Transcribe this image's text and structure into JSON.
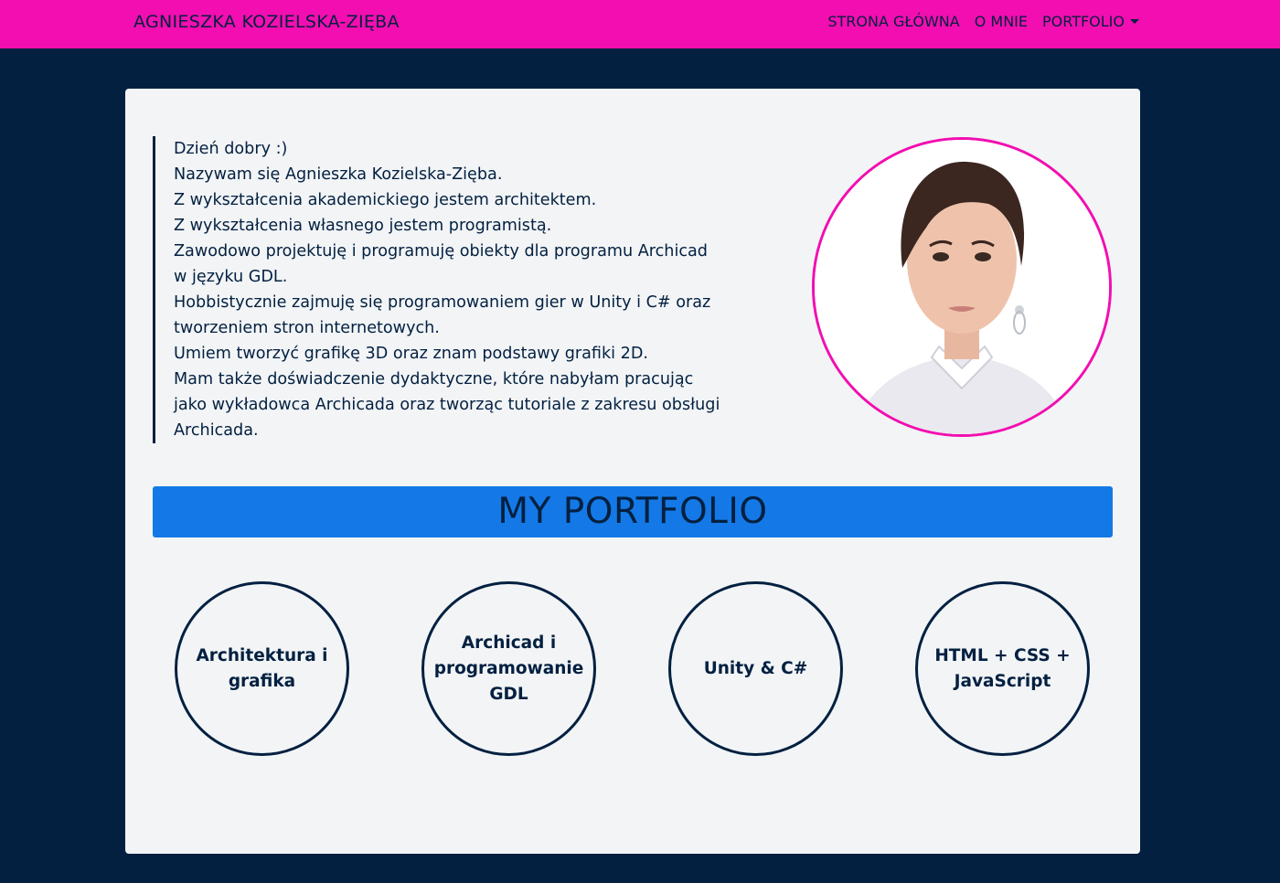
{
  "navbar": {
    "brand": "AGNIESZKA KOZIELSKA-ZIĘBA",
    "links": [
      "STRONA GŁÓWNA",
      "O MNIE",
      "PORTFOLIO"
    ]
  },
  "intro": {
    "lines": [
      "Dzień dobry :)",
      "Nazywam się Agnieszka Kozielska-Zięba.",
      "Z wykształcenia akademickiego jestem architektem.",
      "Z wykształcenia własnego jestem programistą.",
      "Zawodowo projektuję i programuję obiekty dla programu Archicad",
      "w języku GDL.",
      "Hobbistycznie zajmuję się programowaniem gier w Unity i C# oraz",
      "tworzeniem stron internetowych.",
      "Umiem tworzyć grafikę 3D oraz znam podstawy grafiki 2D.",
      "Mam także doświadczenie dydaktyczne, które nabyłam pracując",
      "jako wykładowca Archicada oraz tworząc tutoriale z zakresu obsługi",
      "Archicada."
    ]
  },
  "portfolio": {
    "title": "MY PORTFOLIO",
    "items": [
      "Architektura i grafika",
      "Archicad i programowanie GDL",
      "Unity & C#",
      "HTML + CSS + JavaScript"
    ]
  },
  "colors": {
    "navbar": "#f20eb0",
    "background": "#032040",
    "card": "#f2f4f6",
    "banner": "#1479e6",
    "text": "#032040",
    "avatar_border": "#f20eb0"
  }
}
